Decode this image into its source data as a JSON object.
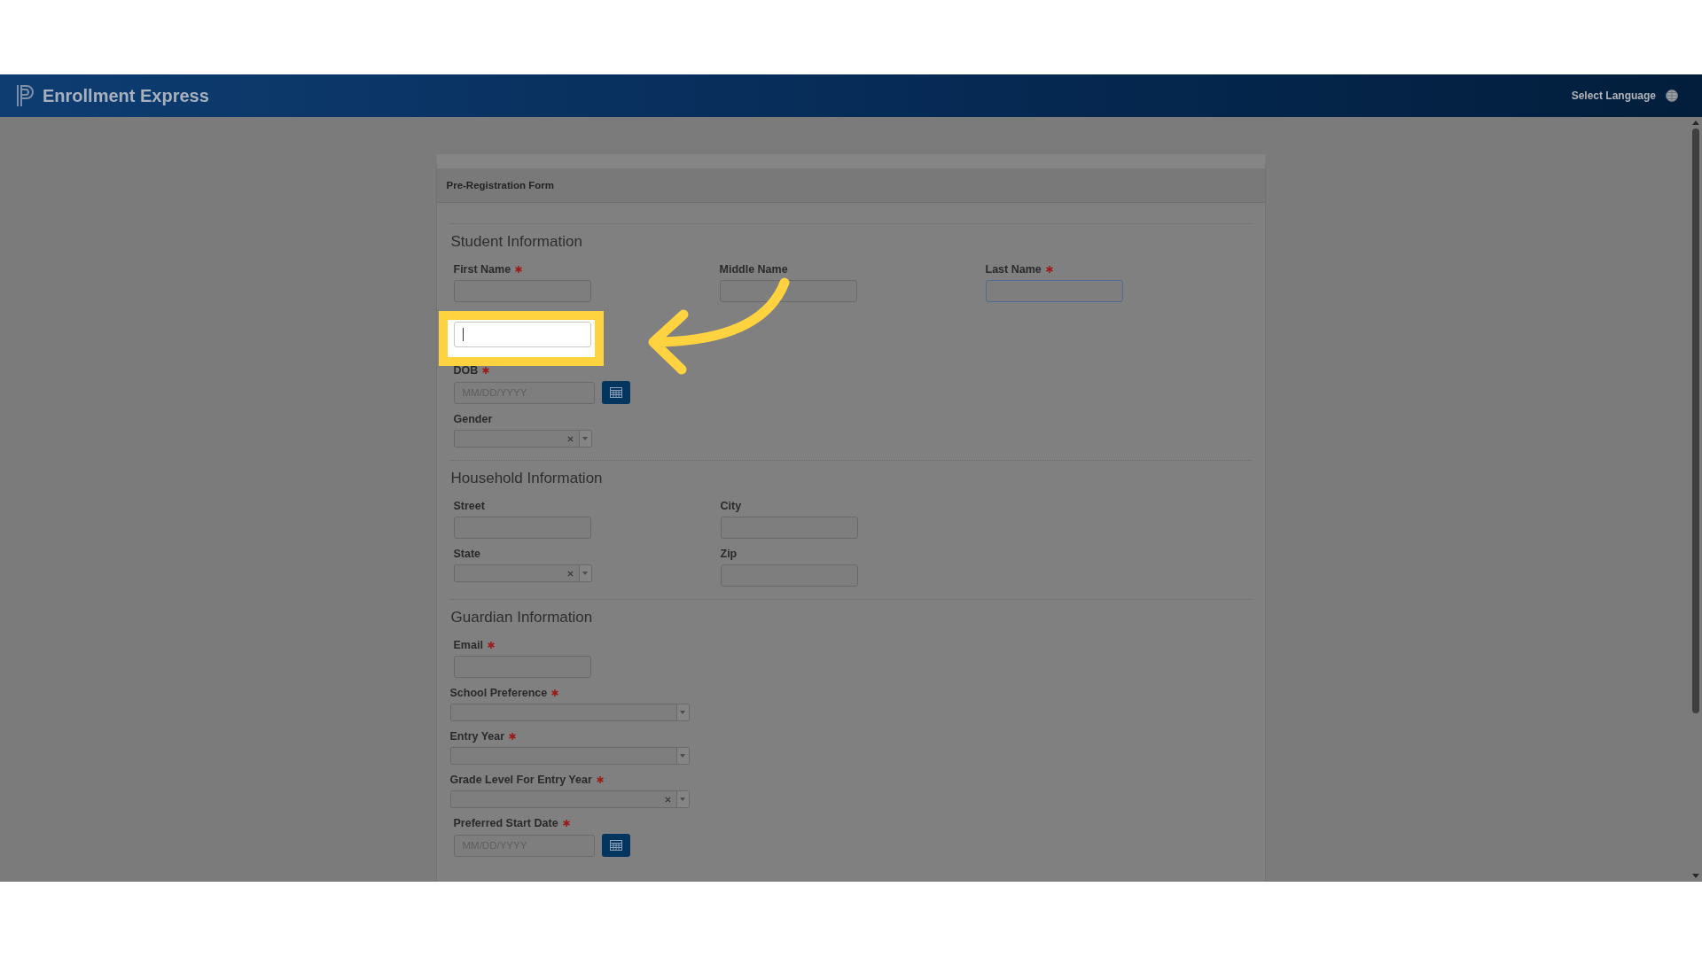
{
  "header": {
    "brand": "Enrollment Express",
    "language": "Select Language"
  },
  "form": {
    "title": "Pre-Registration Form",
    "sections": [
      {
        "title": "Student Information",
        "rows": [
          {
            "fields": [
              {
                "kind": "text",
                "label": "First Name",
                "required": true,
                "focused": false
              },
              {
                "kind": "text",
                "label": "Middle Name",
                "required": false,
                "focused": false
              },
              {
                "kind": "text",
                "label": "Last Name",
                "required": true,
                "focused": true
              }
            ]
          },
          {
            "fields": [
              {
                "kind": "highlight"
              }
            ]
          },
          {
            "fields": [
              {
                "kind": "date",
                "label": "DOB",
                "required": true,
                "placeholder": "MM/DD/YYYY"
              }
            ]
          },
          {
            "fields": [
              {
                "kind": "select",
                "label": "Gender",
                "required": false,
                "clearable": true
              }
            ]
          }
        ]
      },
      {
        "title": "Household Information",
        "rows": [
          {
            "fields": [
              {
                "kind": "text",
                "label": "Street",
                "required": false,
                "focused": false
              },
              {
                "kind": "text",
                "label": "City",
                "required": false,
                "focused": false
              }
            ]
          },
          {
            "fields": [
              {
                "kind": "select",
                "label": "State",
                "required": false,
                "clearable": true
              },
              {
                "kind": "text",
                "label": "Zip",
                "required": false,
                "focused": false
              }
            ]
          }
        ]
      },
      {
        "title": "Guardian Information",
        "rows": [
          {
            "fields": [
              {
                "kind": "text",
                "label": "Email",
                "required": true,
                "focused": false
              }
            ]
          },
          {
            "fields": [
              {
                "kind": "combo",
                "label": "School Preference",
                "required": true,
                "clearable": false
              }
            ]
          },
          {
            "fields": [
              {
                "kind": "combo",
                "label": "Entry Year",
                "required": true,
                "clearable": false
              }
            ]
          },
          {
            "fields": [
              {
                "kind": "combo",
                "label": "Grade Level For Entry Year",
                "required": true,
                "clearable": true
              }
            ]
          },
          {
            "fields": [
              {
                "kind": "date",
                "label": "Preferred Start Date",
                "required": true,
                "placeholder": "MM/DD/YYYY"
              }
            ]
          }
        ]
      }
    ]
  }
}
